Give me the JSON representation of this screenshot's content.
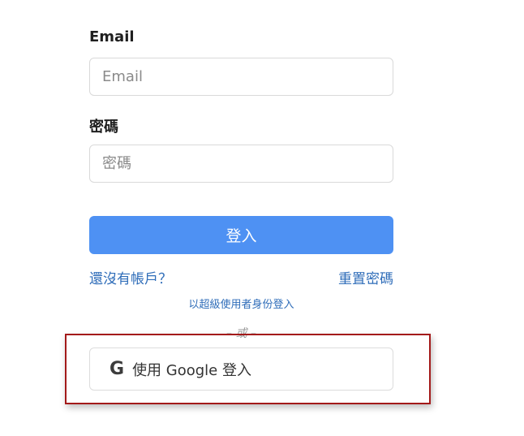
{
  "form": {
    "email_label": "Email",
    "email_placeholder": "Email",
    "password_label": "密碼",
    "password_placeholder": "密碼",
    "login_button": "登入",
    "signup_link": "還沒有帳戶？",
    "reset_link": "重置密碼",
    "superuser_link": "以超級使用者身份登入",
    "divider": "– 或 –",
    "google_button": "使用 Google 登入",
    "google_icon": "G"
  },
  "colors": {
    "primary": "#4e91f3",
    "link": "#2f6db9",
    "highlight_border": "#a31a1a"
  }
}
